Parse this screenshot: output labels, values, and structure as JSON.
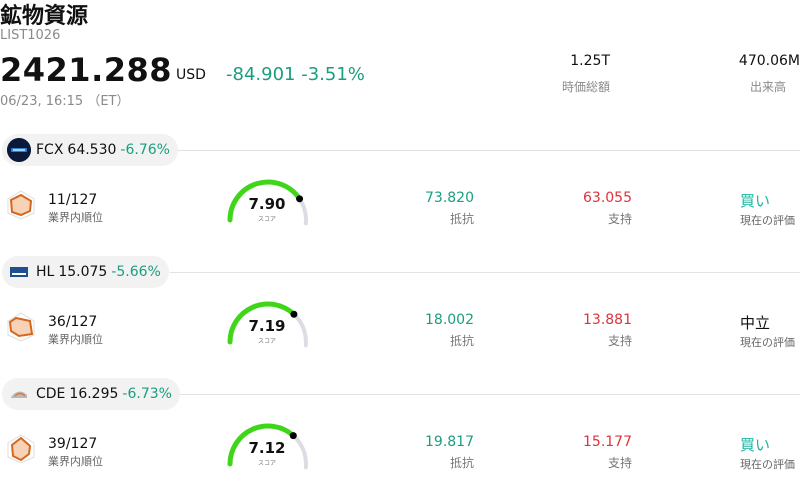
{
  "header": {
    "title": "鉱物資源",
    "code": "LIST1026",
    "price": "2421.288",
    "currency": "USD",
    "change": "-84.901",
    "change_pct": "-3.51%",
    "timestamp": "06/23, 16:15 （ET）",
    "market_cap_value": "1.25T",
    "market_cap_label": "時価総額",
    "volume_value": "470.06M",
    "volume_label": "出来高"
  },
  "stocks": [
    {
      "ticker": "FCX",
      "price": "64.530",
      "pct": "-6.76%",
      "logo_icon": "fcx-logo-icon",
      "rank": "11/127",
      "rank_label": "業界内順位",
      "score": "7.90",
      "score_value": 7.9,
      "score_label": "スコア",
      "resistance": "73.820",
      "resistance_label": "抵抗",
      "support": "63.055",
      "support_label": "支持",
      "evaluation": "買い",
      "evaluation_label": "現在の評価"
    },
    {
      "ticker": "HL",
      "price": "15.075",
      "pct": "-5.66%",
      "logo_icon": "hl-logo-icon",
      "rank": "36/127",
      "rank_label": "業界内順位",
      "score": "7.19",
      "score_value": 7.19,
      "score_label": "スコア",
      "resistance": "18.002",
      "resistance_label": "抵抗",
      "support": "13.881",
      "support_label": "支持",
      "evaluation": "中立",
      "evaluation_label": "現在の評価"
    },
    {
      "ticker": "CDE",
      "price": "16.295",
      "pct": "-6.73%",
      "logo_icon": "cde-logo-icon",
      "rank": "39/127",
      "rank_label": "業界内順位",
      "score": "7.12",
      "score_value": 7.12,
      "score_label": "スコア",
      "resistance": "19.817",
      "resistance_label": "抵抗",
      "support": "15.177",
      "support_label": "支持",
      "evaluation": "買い",
      "evaluation_label": "現在の評価"
    }
  ],
  "colors": {
    "up_accent": "#1a9e7f",
    "support_red": "#e0323c",
    "buy_teal": "#1ab5a0",
    "gauge_green": "#3fd61a",
    "gauge_track": "#dcdce4",
    "radar_orange": "#d2691e"
  }
}
